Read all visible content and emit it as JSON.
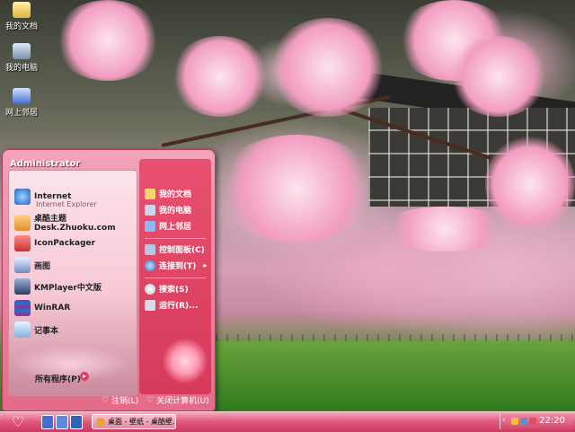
{
  "desktop": {
    "icons": [
      {
        "name": "my-documents",
        "label": "我的文档"
      },
      {
        "name": "my-computer",
        "label": "我的电脑"
      },
      {
        "name": "network",
        "label": "网上邻居"
      }
    ]
  },
  "start_menu": {
    "user": "Administrator",
    "pinned": [
      {
        "label": "Internet",
        "sub": "Internet Explorer",
        "icon": "ie-icon"
      },
      {
        "label": "桌酷主题Desk.Zhuoku.com",
        "sub": "",
        "icon": "zhuoku-icon"
      },
      {
        "label": "IconPackager",
        "sub": "",
        "icon": "iconpackager-icon"
      },
      {
        "label": "画图",
        "sub": "",
        "icon": "paint-icon"
      },
      {
        "label": "KMPlayer中文版",
        "sub": "",
        "icon": "kmplayer-icon"
      },
      {
        "label": "WinRAR",
        "sub": "",
        "icon": "winrar-icon"
      },
      {
        "label": "记事本",
        "sub": "",
        "icon": "notepad-icon"
      }
    ],
    "all_programs": "所有程序(P)",
    "right": [
      {
        "label": "我的文档",
        "icon": "documents-icon"
      },
      {
        "label": "我的电脑",
        "icon": "computer-icon"
      },
      {
        "label": "网上邻居",
        "icon": "network-icon"
      },
      {
        "label": "控制面板(C)",
        "icon": "control-panel-icon"
      },
      {
        "label": "连接到(T)",
        "icon": "connect-icon"
      },
      {
        "label": "搜索(S)",
        "icon": "search-icon"
      },
      {
        "label": "运行(R)...",
        "icon": "run-icon"
      }
    ],
    "logoff": "注销(L)",
    "shutdown": "关闭计算机(U)"
  },
  "taskbar": {
    "start_glyph": "♡",
    "task_label": "桌面 - 壁纸 - 桌酷壁...",
    "clock": "22:20"
  },
  "colors": {
    "accent": "#e2557a",
    "menu_bg": "#f2a3ba"
  }
}
